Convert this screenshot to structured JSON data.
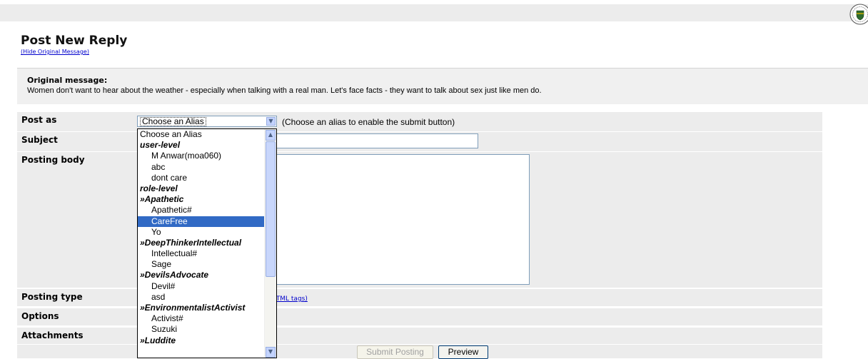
{
  "header": {
    "seal_icon": "university-seal-icon"
  },
  "page": {
    "title": "Post New Reply",
    "hide_link": "(Hide Original Message)"
  },
  "original": {
    "label": "Original message:",
    "text": "Women don't want to hear about the weather - especially when talking with a real man. Let's face facts - they want to talk about sex just like men do."
  },
  "form": {
    "post_as_label": "Post as",
    "subject_label": "Subject",
    "body_label": "Posting body",
    "type_label": "Posting type",
    "options_label": "Options",
    "attachments_label": "Attachments",
    "alias_selected": "Choose an Alias",
    "alias_hint": "(Choose an alias to enable the submit button)",
    "html_tags_link": "HTML tags)",
    "subject_value": "",
    "body_value": "",
    "submit_label": "Submit Posting",
    "preview_label": "Preview"
  },
  "dropdown": {
    "items": [
      {
        "label": "Choose an Alias",
        "kind": "first"
      },
      {
        "label": "user-level",
        "kind": "group"
      },
      {
        "label": "M Anwar(moa060)",
        "kind": "opt"
      },
      {
        "label": "abc",
        "kind": "opt"
      },
      {
        "label": "dont care",
        "kind": "opt"
      },
      {
        "label": "role-level",
        "kind": "group"
      },
      {
        "label": "»Apathetic",
        "kind": "group"
      },
      {
        "label": "Apathetic#",
        "kind": "opt"
      },
      {
        "label": "CareFree",
        "kind": "opt",
        "selected": true
      },
      {
        "label": "Yo",
        "kind": "opt"
      },
      {
        "label": "»DeepThinkerIntellectual",
        "kind": "group"
      },
      {
        "label": "Intellectual#",
        "kind": "opt"
      },
      {
        "label": "Sage",
        "kind": "opt"
      },
      {
        "label": "»DevilsAdvocate",
        "kind": "group"
      },
      {
        "label": "Devil#",
        "kind": "opt"
      },
      {
        "label": "asd",
        "kind": "opt"
      },
      {
        "label": "»EnvironmentalistActivist",
        "kind": "group"
      },
      {
        "label": "Activist#",
        "kind": "opt"
      },
      {
        "label": "Suzuki",
        "kind": "opt"
      },
      {
        "label": "»Luddite",
        "kind": "group"
      }
    ],
    "selected_color": "#316ac5"
  }
}
